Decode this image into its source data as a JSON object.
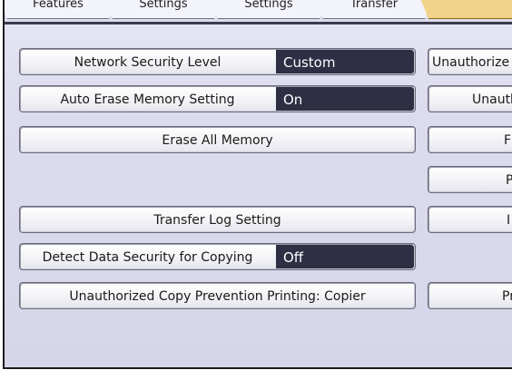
{
  "tabs": [
    {
      "label": "Features"
    },
    {
      "label": "Settings"
    },
    {
      "label": "Settings"
    },
    {
      "label": "Transfer"
    },
    {
      "label": ""
    }
  ],
  "left_buttons": {
    "network_security_level": {
      "label": "Network Security Level",
      "value": "Custom"
    },
    "auto_erase_memory": {
      "label": "Auto Erase Memory Setting",
      "value": "On"
    },
    "erase_all_memory": {
      "label": "Erase All Memory"
    },
    "transfer_log_setting": {
      "label": "Transfer Log Setting"
    },
    "detect_data_security": {
      "label": "Detect Data Security for Copying",
      "value": "Off"
    },
    "unauthorized_copy_prevention": {
      "label": "Unauthorized Copy Prevention Printing: Copier"
    }
  },
  "right_buttons": {
    "row1": {
      "label": "Unauthorize"
    },
    "row2": {
      "label": "Unauth"
    },
    "row3": {
      "label": "F"
    },
    "row4": {
      "label": "P"
    },
    "row5": {
      "label": "I"
    },
    "row7": {
      "label": "Pr"
    }
  },
  "colors": {
    "value_background": "#2e2e44",
    "active_tab": "#f1d38a"
  }
}
